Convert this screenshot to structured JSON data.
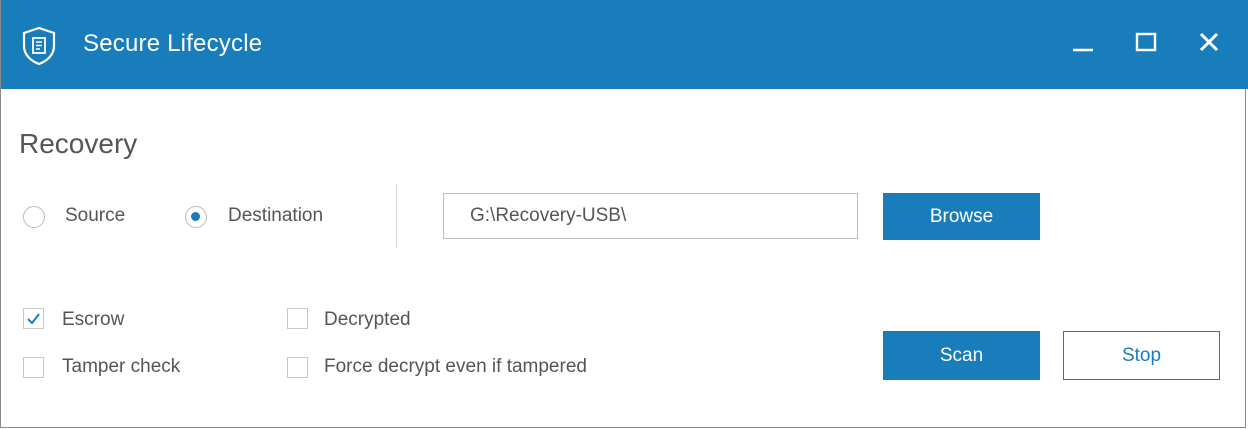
{
  "window": {
    "title": "Secure Lifecycle",
    "icon": "shield-document-icon",
    "controls": [
      "minimize-icon",
      "maximize-icon",
      "close-icon"
    ]
  },
  "recovery": {
    "heading": "Recovery",
    "mode_options": [
      {
        "label": "Source",
        "selected": false
      },
      {
        "label": "Destination",
        "selected": true
      }
    ],
    "path": {
      "value": "G:\\Recovery-USB\\"
    },
    "browse_label": "Browse"
  },
  "options": [
    {
      "label": "Escrow",
      "checked": true
    },
    {
      "label": "Decrypted",
      "checked": false
    },
    {
      "label": "Tamper check",
      "checked": false
    },
    {
      "label": "Force decrypt even if tampered",
      "checked": false
    }
  ],
  "actions": {
    "scan_label": "Scan",
    "stop_label": "Stop"
  },
  "colors": {
    "accent": "#1a7dbb"
  }
}
